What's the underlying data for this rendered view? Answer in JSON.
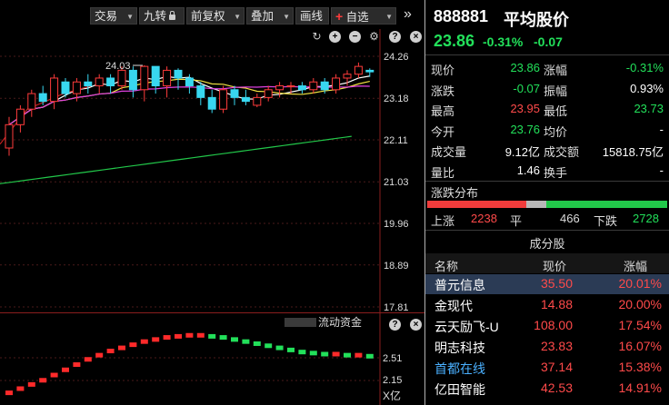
{
  "toolbar": {
    "trade_label": "交易",
    "nine_turn_label": "九转",
    "adjust_label": "前复权",
    "overlay_label": "叠加",
    "draw_label": "画线",
    "watchlist_label": "自选"
  },
  "stock": {
    "code": "888881",
    "name": "平均股价",
    "price": "23.86",
    "change_pct": "-0.31%",
    "change": "-0.07"
  },
  "quote": [
    {
      "l1": "现价",
      "v1": "23.86",
      "c1": "green",
      "l2": "涨幅",
      "v2": "-0.31%",
      "c2": "green"
    },
    {
      "l1": "涨跌",
      "v1": "-0.07",
      "c1": "green",
      "l2": "振幅",
      "v2": "0.93%",
      "c2": "white"
    },
    {
      "l1": "最高",
      "v1": "23.95",
      "c1": "red",
      "l2": "最低",
      "v2": "23.73",
      "c2": "green"
    },
    {
      "l1": "今开",
      "v1": "23.76",
      "c1": "green",
      "l2": "均价",
      "v2": "-",
      "c2": "white"
    },
    {
      "l1": "成交量",
      "v1": "9.12亿",
      "c1": "white",
      "l2": "成交额",
      "v2": "15818.75亿",
      "c2": "white"
    },
    {
      "l1": "量比",
      "v1": "1.46",
      "c1": "white",
      "l2": "换手",
      "v2": "-",
      "c2": "white"
    }
  ],
  "distribution": {
    "title": "涨跌分布",
    "up_label": "上涨",
    "up_count": "2238",
    "flat_label": "平",
    "flat_count": "466",
    "down_label": "下跌",
    "down_count": "2728",
    "up": 2238,
    "flat": 466,
    "down": 2728,
    "colors": {
      "up": "#f03c3c",
      "flat": "#b8b8b8",
      "down": "#22c84a"
    }
  },
  "components": {
    "title": "成分股",
    "headers": [
      "名称",
      "现价",
      "涨幅"
    ],
    "rows": [
      {
        "name": "普元信息",
        "price": "35.50",
        "change": "20.01%",
        "selected": true
      },
      {
        "name": "金现代",
        "price": "14.88",
        "change": "20.00%"
      },
      {
        "name": "云天励飞-U",
        "price": "108.00",
        "change": "17.54%"
      },
      {
        "name": "明志科技",
        "price": "23.83",
        "change": "16.07%"
      },
      {
        "name": "首都在线",
        "price": "37.14",
        "change": "15.38%",
        "highlight": true
      },
      {
        "name": "亿田智能",
        "price": "42.53",
        "change": "14.91%"
      }
    ]
  },
  "chart": {
    "price_axis": [
      "24.26",
      "23.18",
      "22.11",
      "21.03",
      "19.96",
      "18.89",
      "17.81"
    ],
    "high_label": "24.03",
    "sub_title": "流动资金",
    "sub_axis": [
      "2.51",
      "2.15"
    ],
    "sub_unit": "X亿",
    "candles": [
      [
        21.9,
        22.5,
        21.7,
        22.7
      ],
      [
        22.5,
        22.9,
        22.3,
        23.0
      ],
      [
        22.9,
        23.3,
        22.7,
        23.4
      ],
      [
        23.3,
        23.1,
        23.0,
        23.5
      ],
      [
        23.1,
        23.7,
        22.9,
        23.8
      ],
      [
        23.6,
        23.3,
        23.2,
        23.7
      ],
      [
        23.3,
        23.6,
        23.1,
        23.7
      ],
      [
        23.6,
        23.5,
        23.3,
        23.8
      ],
      [
        23.5,
        23.7,
        23.3,
        23.8
      ],
      [
        23.7,
        23.5,
        23.3,
        23.8
      ],
      [
        23.5,
        23.9,
        23.4,
        24.0
      ],
      [
        23.9,
        23.4,
        23.2,
        24.0
      ],
      [
        23.4,
        24.0,
        23.1,
        24.03
      ],
      [
        24.0,
        23.5,
        23.3,
        24.0
      ],
      [
        23.5,
        23.9,
        23.2,
        24.0
      ],
      [
        23.9,
        23.7,
        23.4,
        23.95
      ],
      [
        23.7,
        23.5,
        23.3,
        23.8
      ],
      [
        23.5,
        23.2,
        23.0,
        23.6
      ],
      [
        23.2,
        22.9,
        22.8,
        23.4
      ],
      [
        22.9,
        23.4,
        22.8,
        23.5
      ],
      [
        23.4,
        23.2,
        23.0,
        23.5
      ],
      [
        23.2,
        23.1,
        23.0,
        23.4
      ],
      [
        23.0,
        23.2,
        22.95,
        23.3
      ],
      [
        23.2,
        23.4,
        23.1,
        23.5
      ],
      [
        23.4,
        23.5,
        23.2,
        23.6
      ],
      [
        23.5,
        23.5,
        23.3,
        23.6
      ],
      [
        23.5,
        23.4,
        23.3,
        23.6
      ],
      [
        23.4,
        23.6,
        23.3,
        23.7
      ],
      [
        23.6,
        23.4,
        23.3,
        23.7
      ],
      [
        23.4,
        23.7,
        23.3,
        23.8
      ],
      [
        23.7,
        23.8,
        23.5,
        23.9
      ],
      [
        23.8,
        24.0,
        23.7,
        24.1
      ],
      [
        23.9,
        23.86,
        23.73,
        23.95
      ]
    ],
    "flow": [
      2.06,
      2.1,
      2.14,
      2.18,
      2.23,
      2.28,
      2.33,
      2.38,
      2.42,
      2.46,
      2.49,
      2.52,
      2.55,
      2.57,
      2.59,
      2.6,
      2.61,
      2.61,
      2.6,
      2.59,
      2.57,
      2.55,
      2.53,
      2.51,
      2.49,
      2.47,
      2.45,
      2.44,
      2.43,
      2.43,
      2.42,
      2.42,
      2.41
    ]
  }
}
